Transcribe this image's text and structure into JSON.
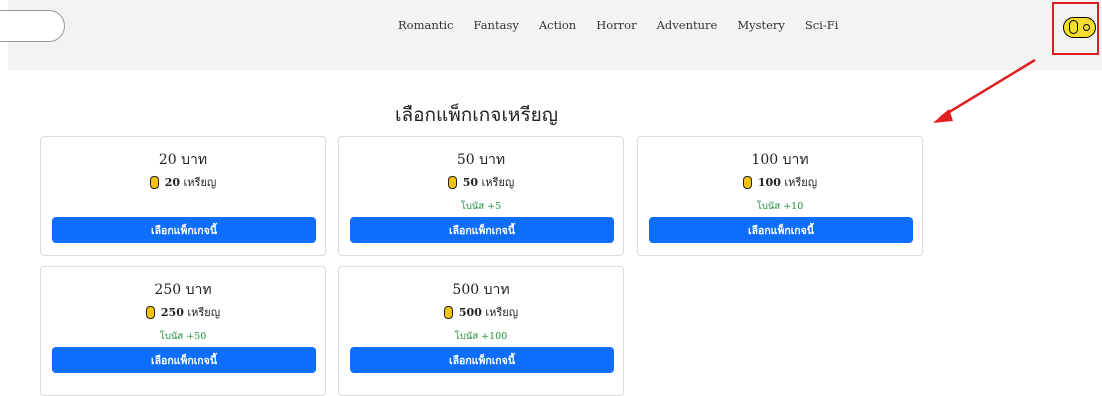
{
  "nav": {
    "items": [
      "Romantic",
      "Fantasy",
      "Action",
      "Horror",
      "Adventure",
      "Mystery",
      "Sci-Fi"
    ]
  },
  "coin_toggle": {
    "icon": "coin-icon",
    "color": "#f6dd2d"
  },
  "page_title": "เลือกแพ็กเกจเหรียญ",
  "packages": [
    {
      "price": "20 บาท",
      "coins": "20",
      "coin_unit": "เหรียญ",
      "bonus": "",
      "button": "เลือกแพ็กเกจนี้"
    },
    {
      "price": "50 บาท",
      "coins": "50",
      "coin_unit": "เหรียญ",
      "bonus": "โบนัส +5",
      "button": "เลือกแพ็กเกจนี้"
    },
    {
      "price": "100 บาท",
      "coins": "100",
      "coin_unit": "เหรียญ",
      "bonus": "โบนัส +10",
      "button": "เลือกแพ็กเกจนี้"
    },
    {
      "price": "250 บาท",
      "coins": "250",
      "coin_unit": "เหรียญ",
      "bonus": "โบนัส +50",
      "button": "เลือกแพ็กเกจนี้"
    },
    {
      "price": "500 บาท",
      "coins": "500",
      "coin_unit": "เหรียญ",
      "bonus": "โบนัส +100",
      "button": "เลือกแพ็กเกจนี้"
    }
  ],
  "colors": {
    "primary_button": "#0d6efd",
    "bonus_text": "#1e8f3a",
    "annotation_red": "#e02020",
    "coin_gold": "#f4c20d"
  }
}
